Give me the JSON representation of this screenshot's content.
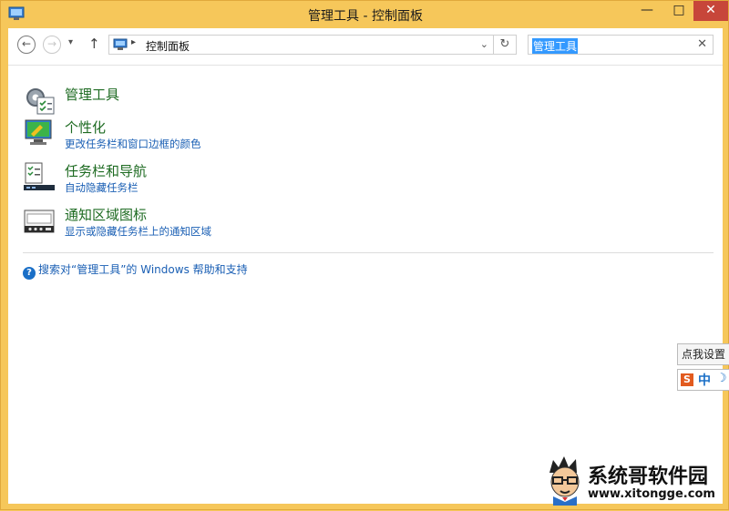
{
  "window": {
    "title": "管理工具 - 控制面板",
    "controls": {
      "minimize": "—",
      "maximize": "□",
      "close": "✕"
    }
  },
  "nav": {
    "back": "←",
    "forward": "→",
    "recent": "▾",
    "up": "↑"
  },
  "address": {
    "separator": "▸",
    "path": "控制面板",
    "dropdown": "⌄",
    "refresh": "↻"
  },
  "search": {
    "value": "管理工具",
    "clear": "✕"
  },
  "items": [
    {
      "icon": "admin-tools-icon",
      "title": "管理工具"
    },
    {
      "icon": "personalization-icon",
      "title": "个性化",
      "subtitle": "更改任务栏和窗口边框的颜色"
    },
    {
      "icon": "taskbar-navigation-icon",
      "title": "任务栏和导航",
      "subtitle": "自动隐藏任务栏"
    },
    {
      "icon": "notification-area-icon",
      "title": "通知区域图标",
      "subtitle": "显示或隐藏任务栏上的通知区域"
    }
  ],
  "help": {
    "icon": "?",
    "text": "搜索对“管理工具”的 Windows 帮助和支持"
  },
  "ime": {
    "tooltip": "点我设置",
    "logo": "S",
    "mode": "中",
    "moon": "☽"
  },
  "watermark": {
    "title": "系统哥软件园",
    "url": "www.xitongge.com"
  },
  "colors": {
    "frame": "#f6c75a",
    "link_title": "#1e6b22",
    "link_sub": "#1a5fb4",
    "close": "#c7463a",
    "selection": "#3399ff"
  }
}
